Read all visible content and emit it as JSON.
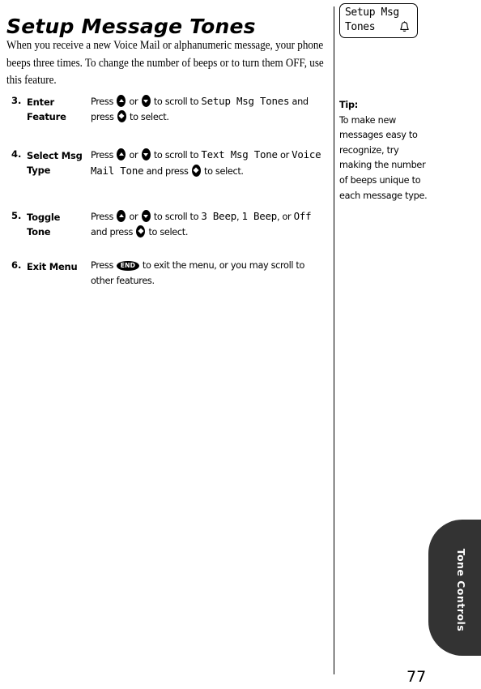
{
  "page": {
    "title": "Setup Message Tones",
    "intro": "When you receive a new Voice Mail or alphanumeric message, your phone beeps three times. To change the number of beeps or to turn them OFF, use this feature.",
    "number": "77"
  },
  "steps": [
    {
      "number": "3.",
      "label": "Enter Feature",
      "body_parts": [
        {
          "type": "text",
          "value": "Press "
        },
        {
          "type": "key",
          "value": "scroll-up-key"
        },
        {
          "type": "text",
          "value": " or "
        },
        {
          "type": "key",
          "value": "scroll-down-key"
        },
        {
          "type": "text",
          "value": " to scroll to "
        },
        {
          "type": "lcd",
          "value": "Setup Msg Tones"
        },
        {
          "type": "text",
          "value": " and press "
        },
        {
          "type": "key",
          "value": "select-key"
        },
        {
          "type": "text",
          "value": " to select."
        }
      ]
    },
    {
      "number": "4.",
      "label": "Select Msg Type",
      "body_parts": [
        {
          "type": "text",
          "value": "Press "
        },
        {
          "type": "key",
          "value": "scroll-up-key"
        },
        {
          "type": "text",
          "value": " or "
        },
        {
          "type": "key",
          "value": "scroll-down-key"
        },
        {
          "type": "text",
          "value": " to scroll to "
        },
        {
          "type": "lcd",
          "value": "Text Msg Tone"
        },
        {
          "type": "text",
          "value": " or "
        },
        {
          "type": "lcd",
          "value": "Voice Mail Tone"
        },
        {
          "type": "text",
          "value": " and press "
        },
        {
          "type": "key",
          "value": "select-key"
        },
        {
          "type": "text",
          "value": " to select."
        }
      ]
    },
    {
      "number": "5.",
      "label": "Toggle Tone",
      "body_parts": [
        {
          "type": "text",
          "value": "Press "
        },
        {
          "type": "key",
          "value": "scroll-up-key"
        },
        {
          "type": "text",
          "value": " or "
        },
        {
          "type": "key",
          "value": "scroll-down-key"
        },
        {
          "type": "text",
          "value": " to scroll to "
        },
        {
          "type": "lcd",
          "value": "3 Beep"
        },
        {
          "type": "text",
          "value": ", "
        },
        {
          "type": "lcd",
          "value": "1 Beep"
        },
        {
          "type": "text",
          "value": ", or "
        },
        {
          "type": "lcd",
          "value": "Off"
        },
        {
          "type": "text",
          "value": " and press "
        },
        {
          "type": "key",
          "value": "select-key"
        },
        {
          "type": "text",
          "value": " to select."
        }
      ]
    },
    {
      "number": "6.",
      "label": "Exit Menu",
      "body_parts": [
        {
          "type": "text",
          "value": "Press "
        },
        {
          "type": "key",
          "value": "end-key"
        },
        {
          "type": "text",
          "value": " to exit the menu, or you may scroll to other features."
        }
      ]
    }
  ],
  "lcd_display": {
    "line1": "Setup Msg",
    "line2": "Tones",
    "icon": "bell-icon"
  },
  "tip": {
    "heading": "Tip:",
    "text": "To make new messages easy to recognize, try making the number of beeps unique to each message type."
  },
  "side_tab": {
    "label": "Tone Controls",
    "color": "#333333"
  },
  "keys": {
    "scroll-up-key": "scroll-up",
    "scroll-down-key": "scroll-down",
    "select-key": "select",
    "end-key": "END"
  }
}
